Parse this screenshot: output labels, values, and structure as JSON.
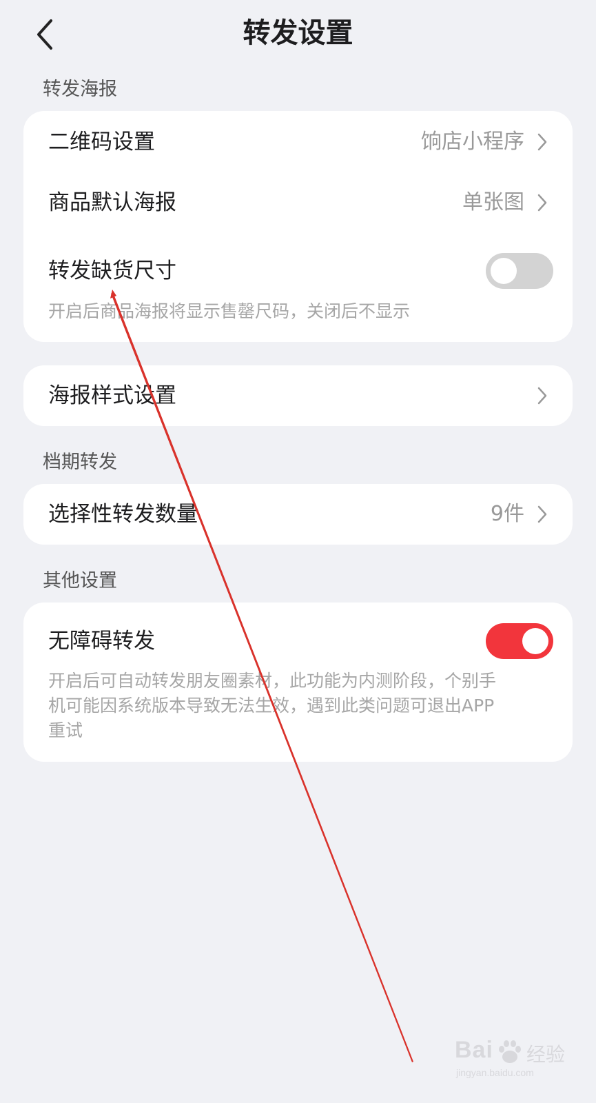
{
  "header": {
    "title": "转发设置"
  },
  "sections": {
    "poster_label": "转发海报",
    "schedule_label": "档期转发",
    "other_label": "其他设置"
  },
  "poster_card": {
    "qrcode": {
      "label": "二维码设置",
      "value": "饷店小程序"
    },
    "default_poster": {
      "label": "商品默认海报",
      "value": "单张图"
    },
    "out_of_stock": {
      "label": "转发缺货尺寸",
      "enabled": false,
      "desc": "开启后商品海报将显示售罄尺码，关闭后不显示"
    }
  },
  "style_card": {
    "label": "海报样式设置"
  },
  "schedule_card": {
    "label": "选择性转发数量",
    "value": "9件"
  },
  "other_card": {
    "label": "无障碍转发",
    "enabled": true,
    "desc_line1": "开启后可自动转发朋友圈素材，此功能为内测阶段，个别手",
    "desc_line2": "机可能因系统版本导致无法生效，遇到此类问题可退出APP",
    "desc_line3": "重试"
  },
  "watermark": {
    "brand": "Bai",
    "cn": "经验",
    "url": "jingyan.baidu.com"
  },
  "colors": {
    "background": "#f0f1f5",
    "card": "#ffffff",
    "toggle_on": "#f2353c",
    "toggle_off": "#d3d3d3",
    "annotation_arrow": "#d9322b"
  }
}
